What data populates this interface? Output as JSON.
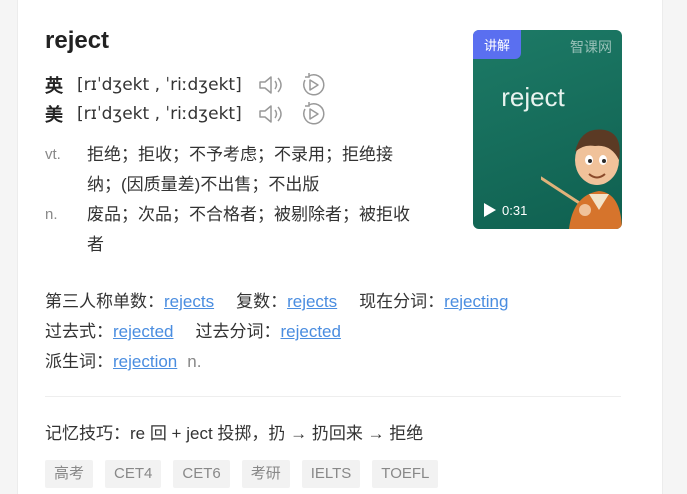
{
  "entry": {
    "word": "reject",
    "pronunciations": [
      {
        "label": "英",
        "ipa": "[rɪˈdʒekt , ˈriːdʒekt]"
      },
      {
        "label": "美",
        "ipa": "[rɪˈdʒekt , ˈriːdʒekt]"
      }
    ],
    "definitions": [
      {
        "pos": "vt.",
        "meaning": "拒绝；拒收；不予考虑；不录用；拒绝接纳；(因质量差)不出售；不出版"
      },
      {
        "pos": "n.",
        "meaning": "废品；次品；不合格者；被剔除者；被拒收者"
      }
    ]
  },
  "video": {
    "badge": "讲解",
    "brand": "智课网",
    "word": "reject",
    "duration": "0:31",
    "play_icon": "play-icon",
    "bg_color": "#136b58",
    "badge_color": "#5a6ff0"
  },
  "forms": {
    "third_person_label": "第三人称单数：",
    "third_person": "rejects",
    "plural_label": "复数：",
    "plural": "rejects",
    "present_participle_label": "现在分词：",
    "present_participle": "rejecting",
    "past_label": "过去式：",
    "past": "rejected",
    "past_participle_label": "过去分词：",
    "past_participle": "rejected",
    "derivative_label": "派生词：",
    "derivative": "rejection",
    "derivative_pos": "n."
  },
  "memory": {
    "text": "记忆技巧：re 回 + ject 投掷，扔 → 扔回来 → 拒绝"
  },
  "tags": [
    "高考",
    "CET4",
    "CET6",
    "考研",
    "IELTS",
    "TOEFL"
  ],
  "colors": {
    "link": "#4a8de0",
    "muted": "#888888",
    "tag_bg": "#f2f2f2"
  }
}
